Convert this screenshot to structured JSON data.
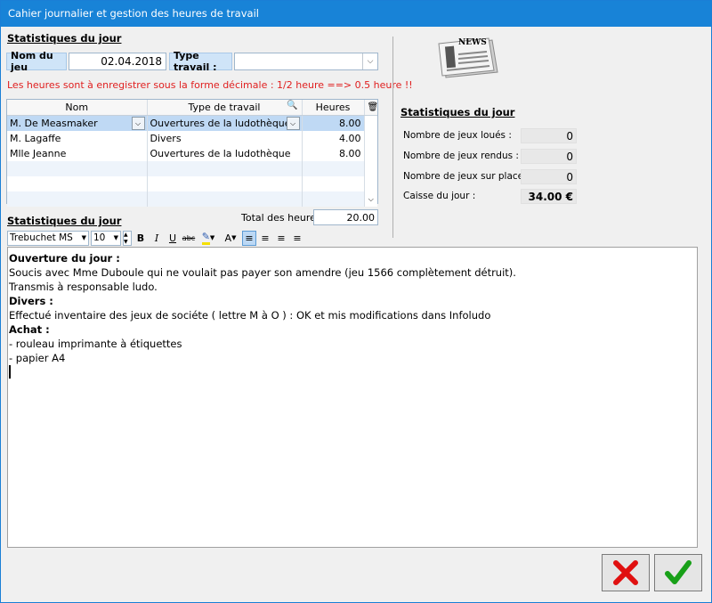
{
  "window": {
    "title": "Cahier journalier et gestion des heures de travail"
  },
  "top_section": {
    "title": "Statistiques du jour"
  },
  "form": {
    "nom_du_jeu_label": "Nom du jeu",
    "nom_du_jeu_value": "02.04.2018",
    "type_travail_label": "Type travail :",
    "type_travail_value": ""
  },
  "warning": "Les heures sont à enregistrer sous la forme décimale : 1/2 heure ==> 0.5 heure !!",
  "grid": {
    "columns": [
      "Nom",
      "Type de travail",
      "Heures"
    ],
    "rows": [
      {
        "nom": "M. De Measmaker",
        "type": "Ouvertures de la ludothèque",
        "heures": "8.00"
      },
      {
        "nom": "M. Lagaffe",
        "type": "Divers",
        "heures": "4.00"
      },
      {
        "nom": "Mlle Jeanne",
        "type": "Ouvertures de la ludothèque",
        "heures": "8.00"
      }
    ]
  },
  "total": {
    "label": "Total des heures",
    "value": "20.00"
  },
  "editor_section": {
    "title": "Statistiques du jour"
  },
  "toolbar": {
    "font": "Trebuchet MS",
    "size": "10",
    "bold": "B",
    "italic": "I",
    "underline": "U",
    "strike": "abc",
    "color": "A"
  },
  "editor": {
    "lines": [
      "Ouverture du jour :",
      "",
      "Soucis avec Mme Duboule qui ne voulait pas payer son amendre (jeu 1566 complètement détruit).",
      "",
      "Transmis à responsable ludo.",
      "",
      "Divers :",
      "",
      "Effectué inventaire des jeux de sociéte ( lettre M à O ) : OK et mis modifications dans Infoludo",
      "",
      "",
      "Achat :",
      "",
      "- rouleau imprimante à étiquettes",
      "- papier A4"
    ]
  },
  "stats": {
    "title": "Statistiques du jour",
    "news_label": "NEWS",
    "items": [
      {
        "label": "Nombre de jeux loués :",
        "value": "0"
      },
      {
        "label": "Nombre de jeux rendus :",
        "value": "0"
      },
      {
        "label": "Nombre de jeux sur place :",
        "value": "0"
      },
      {
        "label": "Caisse du jour :",
        "value": "34.00 €"
      }
    ]
  },
  "colors": {
    "titlebar": "#1883d7",
    "warning": "#e02020",
    "cancel": "#e01010",
    "ok": "#18a018"
  },
  "icons": {
    "cancel": "x-icon",
    "ok": "check-icon",
    "news": "newspaper-icon"
  }
}
